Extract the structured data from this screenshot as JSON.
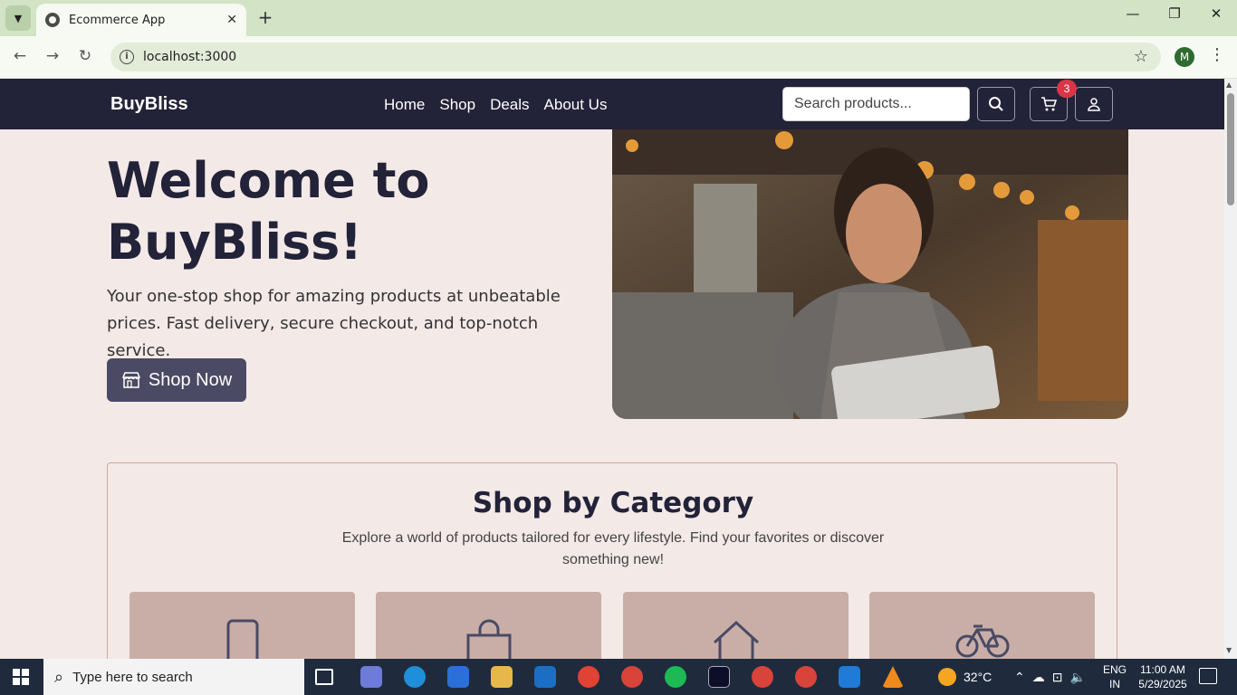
{
  "browser": {
    "tab_title": "Ecommerce App",
    "url": "localhost:3000",
    "profile_initial": "M"
  },
  "site": {
    "brand": "BuyBliss",
    "nav": [
      "Home",
      "Shop",
      "Deals",
      "About Us"
    ],
    "search_placeholder": "Search products...",
    "cart_count": "3"
  },
  "hero": {
    "title": "Welcome to BuyBliss!",
    "subtitle": "Your one-stop shop for amazing products at unbeatable prices. Fast delivery, secure checkout, and top-notch service.",
    "cta_label": "Shop Now"
  },
  "categories": {
    "title": "Shop by Category",
    "description": "Explore a world of products tailored for every lifestyle. Find your favorites or discover something new!",
    "cards": [
      {
        "icon": "phone-icon"
      },
      {
        "icon": "shopping-bag-icon"
      },
      {
        "icon": "home-icon"
      },
      {
        "icon": "bicycle-icon"
      }
    ]
  },
  "taskbar": {
    "search_placeholder": "Type here to search",
    "weather": "32°C",
    "lang_line1": "ENG",
    "lang_line2": "IN",
    "time": "11:00 AM",
    "date": "5/29/2025"
  },
  "colors": {
    "header_bg": "#222238",
    "page_bg": "#f3e9e7",
    "button_bg": "#4a4a64",
    "card_bg": "#c9aea8",
    "badge": "#dc3545"
  }
}
